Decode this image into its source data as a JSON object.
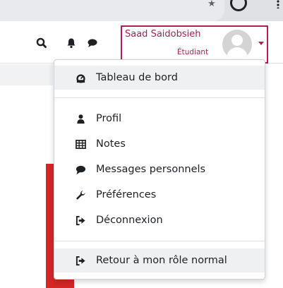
{
  "navbar": {
    "user_name": "Saad Saidobsieh",
    "user_role": "Étudiant"
  },
  "dropdown": {
    "items": [
      {
        "label": "Tableau de bord",
        "icon": "dashboard-icon"
      },
      {
        "label": "Profil",
        "icon": "user-icon"
      },
      {
        "label": "Notes",
        "icon": "table-icon"
      },
      {
        "label": "Messages personnels",
        "icon": "comment-icon"
      },
      {
        "label": "Préférences",
        "icon": "wrench-icon"
      },
      {
        "label": "Déconnexion",
        "icon": "sign-out-icon"
      },
      {
        "label": "Retour à mon rôle normal",
        "icon": "sign-out-icon"
      }
    ]
  },
  "colors": {
    "accent": "#b01f4e",
    "red_block": "#d62626"
  }
}
